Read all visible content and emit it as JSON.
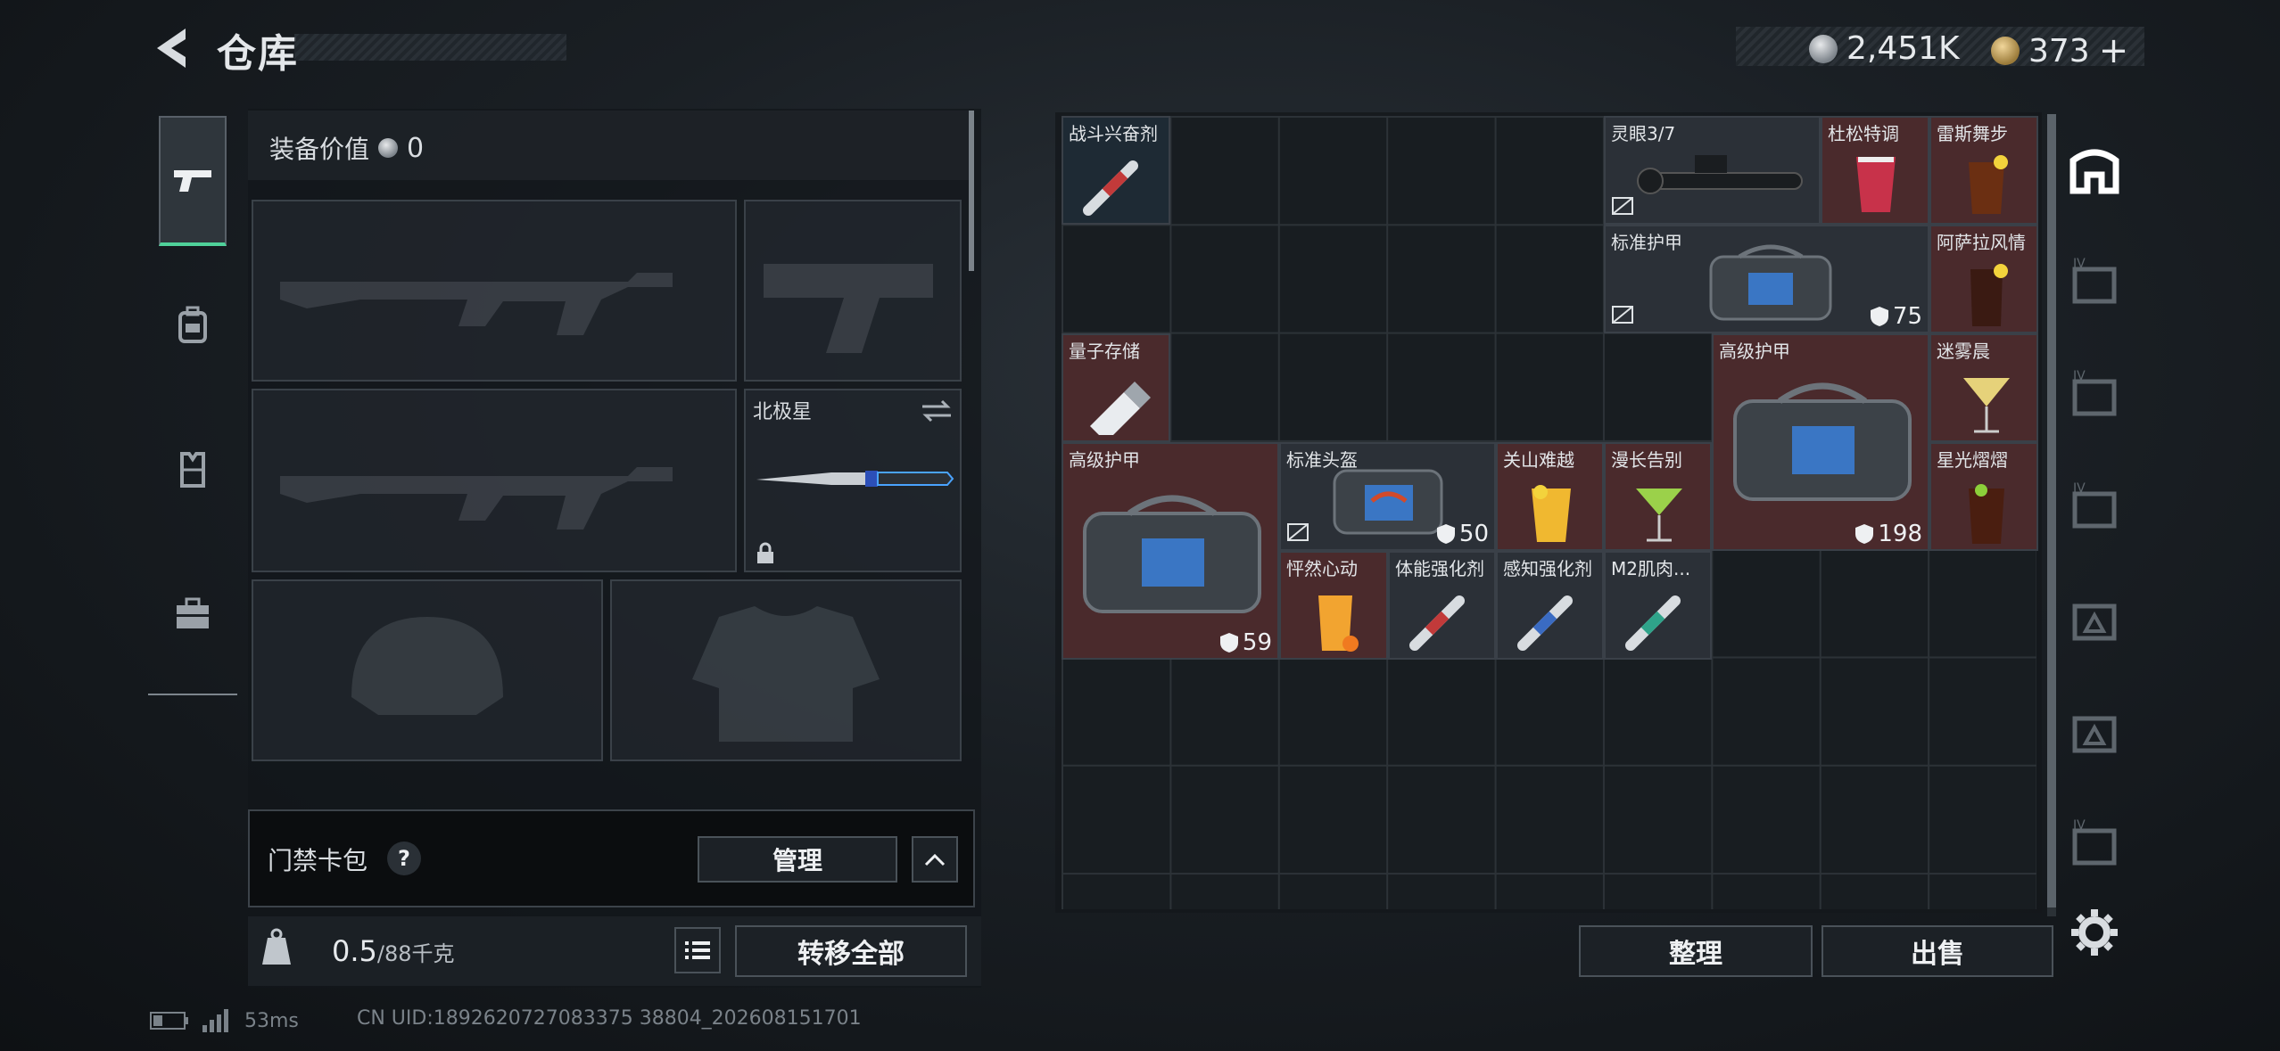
{
  "header": {
    "title": "仓库",
    "currency_silver": "2,451K",
    "currency_gold": "373",
    "add_symbol": "+"
  },
  "colors": {
    "accent_green": "#4fd19a",
    "rarity_red": "#4a2a2c",
    "rarity_gray": "#2b3037"
  },
  "left_tabs": [
    "gun-icon",
    "backpack-icon",
    "vest-icon",
    "toolbox-icon"
  ],
  "equipment": {
    "value_label": "装备价值",
    "value": "0",
    "melee_name": "北极星",
    "card_pack_label": "门禁卡包",
    "card_pack_help": "?",
    "manage_label": "管理",
    "weight_current": "0.5",
    "weight_max": "/88千克",
    "transfer_all_label": "转移全部"
  },
  "stash": {
    "items": [
      {
        "name": "战斗兴奋剂"
      },
      {
        "name": "灵眼3/7"
      },
      {
        "name": "杜松特调"
      },
      {
        "name": "雷斯舞步"
      },
      {
        "name": "标准护甲",
        "durability": "75"
      },
      {
        "name": "阿萨拉风情"
      },
      {
        "name": "量子存储"
      },
      {
        "name": "高级护甲",
        "durability": "198"
      },
      {
        "name": "迷雾晨"
      },
      {
        "name": "高级护甲",
        "durability": "59"
      },
      {
        "name": "标准头盔",
        "durability": "50"
      },
      {
        "name": "关山难越"
      },
      {
        "name": "漫长告别"
      },
      {
        "name": "星光熠熠"
      },
      {
        "name": "怦然心动"
      },
      {
        "name": "体能强化剂"
      },
      {
        "name": "感知强化剂"
      },
      {
        "name": "M2肌肉..."
      }
    ],
    "sort_label": "整理",
    "sell_label": "出售"
  },
  "footer": {
    "ping": "53ms",
    "uid": "CN UID:1892620727083375 38804_202608151701"
  }
}
